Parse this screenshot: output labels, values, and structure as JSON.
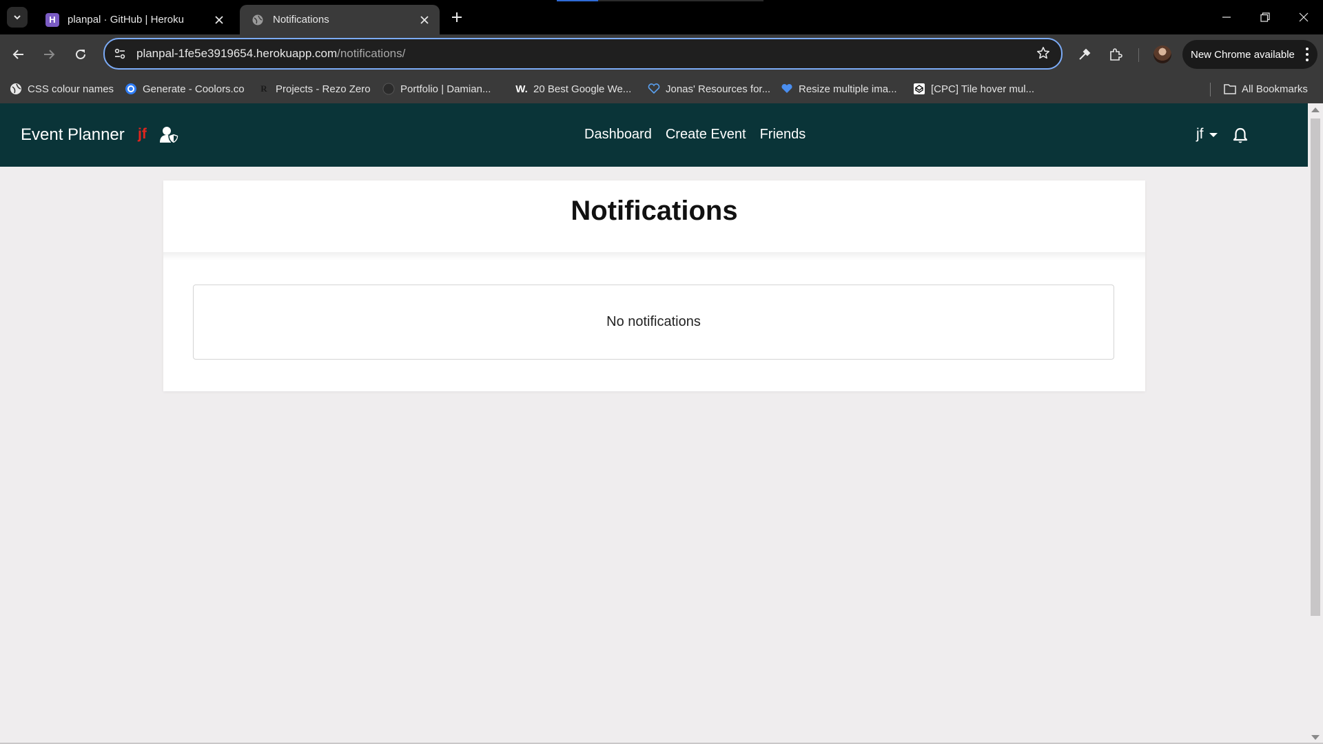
{
  "browser": {
    "tabs": [
      {
        "title": "planpal · GitHub | Heroku",
        "favicon": "heroku-icon",
        "active": false
      },
      {
        "title": "Notifications",
        "favicon": "globe-icon",
        "active": true
      }
    ],
    "url_host": "planpal-1fe5e3919654.herokuapp.com",
    "url_path": "/notifications/",
    "update_button": "New Chrome available",
    "bookmarks": [
      {
        "label": "CSS colour names",
        "icon": "globe-icon"
      },
      {
        "label": "Generate - Coolors.co",
        "icon": "coolors-icon"
      },
      {
        "label": "Projects - Rezo Zero",
        "icon": "rezo-zero-icon"
      },
      {
        "label": "Portfolio | Damian...",
        "icon": "portfolio-icon"
      },
      {
        "label": "20 Best Google We...",
        "icon": "w-icon"
      },
      {
        "label": "Jonas' Resources for...",
        "icon": "heart-icon"
      },
      {
        "label": "Resize multiple ima...",
        "icon": "heart-filled-icon"
      },
      {
        "label": "[CPC] Tile hover mul...",
        "icon": "codepen-icon"
      }
    ],
    "all_bookmarks": "All Bookmarks",
    "colors": {
      "tabbar": "#000000",
      "toolbar": "#3a3a3a",
      "omnibox_border": "#7cacf8"
    }
  },
  "app": {
    "brand": "Event Planner",
    "brand_user": "jf",
    "nav": [
      "Dashboard",
      "Create Event",
      "Friends"
    ],
    "user_menu": "jf",
    "colors": {
      "navbar": "#0a3438",
      "brand_user": "#e2251e",
      "background": "#efedee"
    }
  },
  "notifications": {
    "title": "Notifications",
    "empty_message": "No notifications"
  }
}
